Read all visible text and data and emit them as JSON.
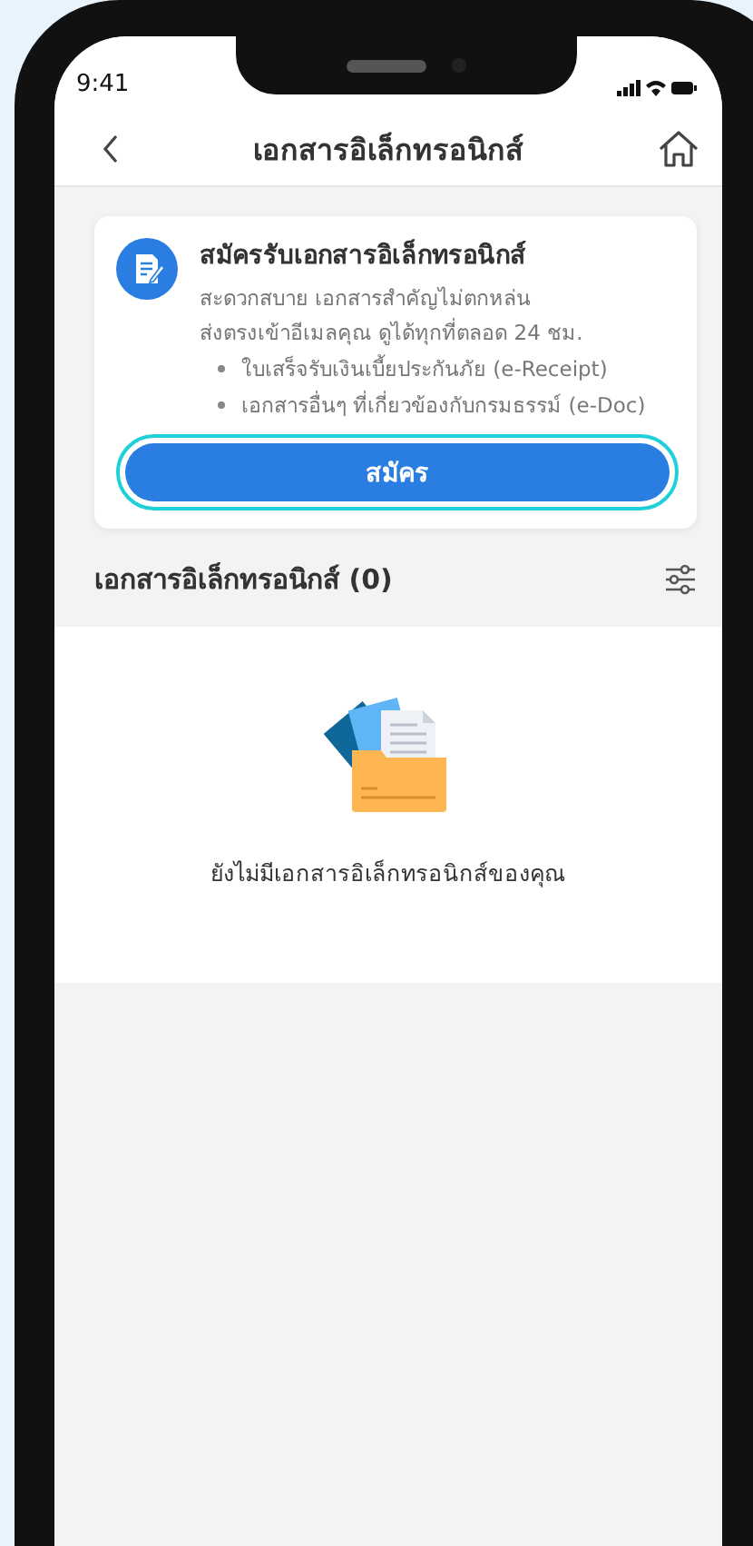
{
  "status_bar": {
    "time": "9:41"
  },
  "nav": {
    "title": "เอกสารอิเล็กทรอนิกส์"
  },
  "signup_card": {
    "title": "สมัครรับเอกสารอิเล็กทรอนิกส์",
    "description_lines": [
      "สะดวกสบาย เอกสารสำคัญไม่ตกหล่น",
      "ส่งตรงเข้าอีเมลคุณ ดูได้ทุกที่ตลอด 24 ชม."
    ],
    "bullets": [
      "ใบเสร็จรับเงินเบี้ยประกันภัย (e-Receipt)",
      "เอกสารอื่นๆ ที่เกี่ยวข้องกับกรมธรรม์ (e-Doc)"
    ],
    "button": {
      "label": "สมัคร",
      "focused": true
    }
  },
  "section": {
    "title": "เอกสารอิเล็กทรอนิกส์ (0)"
  },
  "empty_state": {
    "message": "ยังไม่มีเอกสารอิเล็กทรอนิกส์ของคุณ"
  }
}
